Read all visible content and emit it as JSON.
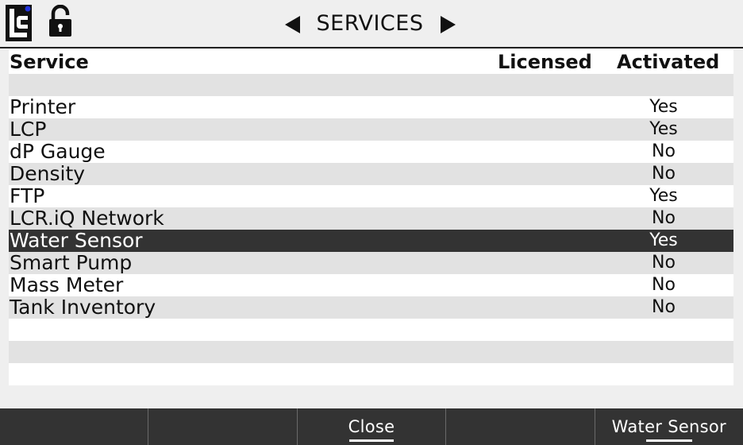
{
  "header": {
    "title": "SERVICES",
    "logo_text": "LC"
  },
  "table": {
    "columns": [
      "Service",
      "Licensed",
      "Activated"
    ],
    "rows": [
      {
        "service": "",
        "licensed": "",
        "activated": ""
      },
      {
        "service": "Printer",
        "licensed": "",
        "activated": "Yes"
      },
      {
        "service": "LCP",
        "licensed": "",
        "activated": "Yes"
      },
      {
        "service": "dP Gauge",
        "licensed": "",
        "activated": "No"
      },
      {
        "service": "Density",
        "licensed": "",
        "activated": "No"
      },
      {
        "service": "FTP",
        "licensed": "",
        "activated": "Yes"
      },
      {
        "service": "LCR.iQ Network",
        "licensed": "",
        "activated": "No"
      },
      {
        "service": "Water Sensor",
        "licensed": "",
        "activated": "Yes"
      },
      {
        "service": "Smart Pump",
        "licensed": "",
        "activated": "No"
      },
      {
        "service": "Mass Meter",
        "licensed": "",
        "activated": "No"
      },
      {
        "service": "Tank Inventory",
        "licensed": "",
        "activated": "No"
      },
      {
        "service": "",
        "licensed": "",
        "activated": ""
      },
      {
        "service": "",
        "licensed": "",
        "activated": ""
      },
      {
        "service": "",
        "licensed": "",
        "activated": ""
      }
    ],
    "selected_index": 7
  },
  "footer": {
    "buttons": [
      "",
      "",
      "Close",
      "",
      "Water Sensor"
    ]
  },
  "colors": {
    "selected_row": "#333333",
    "alt_row": "#e2e2e2",
    "footer": "#333333"
  }
}
